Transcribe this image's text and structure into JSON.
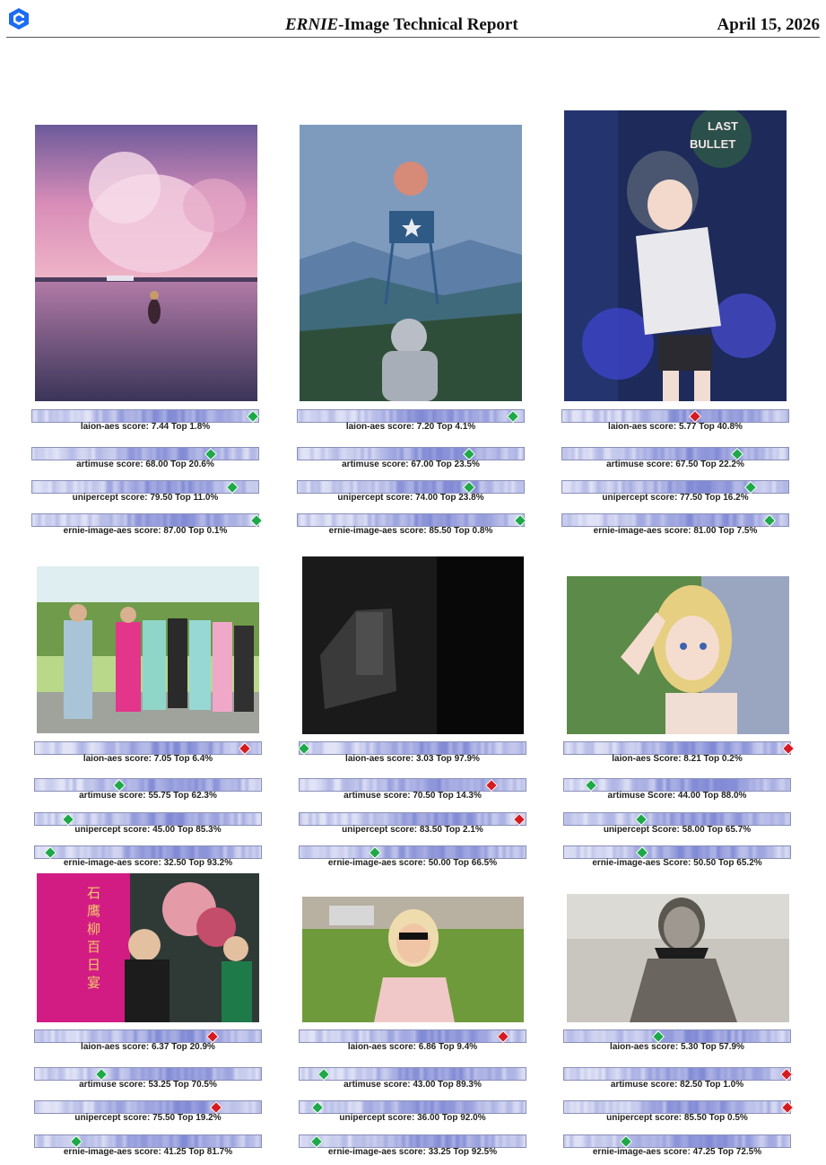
{
  "header": {
    "title_italic": "ERNIE",
    "title_rest": "-Image Technical Report",
    "date": "April 15, 2026"
  },
  "colors": {
    "good_marker": "#1ea84a",
    "bad_marker": "#d51b22",
    "bar_stripe": "#6f79cf",
    "bar_background": "#e8eaf8"
  },
  "panels": [
    {
      "subject": "pink sunset sea swimmer",
      "metrics": [
        {
          "label": "laion-aes score: 7.44 Top 1.8%",
          "percentile": 0.982,
          "marker": "green"
        },
        {
          "label": "artimuse score: 68.00 Top 20.6%",
          "percentile": 0.794,
          "marker": "green"
        },
        {
          "label": "unipercept score: 79.50 Top 11.0%",
          "percentile": 0.89,
          "marker": "green"
        },
        {
          "label": "ernie-image-aes score: 87.00 Top 0.1%",
          "percentile": 0.999,
          "marker": "green"
        }
      ]
    },
    {
      "subject": "astronaut water tower moon",
      "metrics": [
        {
          "label": "laion-aes score: 7.20 Top 4.1%",
          "percentile": 0.959,
          "marker": "green"
        },
        {
          "label": "artimuse score: 67.00 Top 23.5%",
          "percentile": 0.765,
          "marker": "green"
        },
        {
          "label": "unipercept score: 74.00 Top 23.8%",
          "percentile": 0.762,
          "marker": "green"
        },
        {
          "label": "ernie-image-aes score: 85.50 Top 0.8%",
          "percentile": 0.992,
          "marker": "green"
        }
      ]
    },
    {
      "subject": "anime girl last bullet",
      "metrics": [
        {
          "label": "laion-aes score: 5.77 Top 40.8%",
          "percentile": 0.592,
          "marker": "red"
        },
        {
          "label": "artimuse score: 67.50 Top 22.2%",
          "percentile": 0.778,
          "marker": "green"
        },
        {
          "label": "unipercept score: 77.50 Top 16.2%",
          "percentile": 0.838,
          "marker": "green"
        },
        {
          "label": "ernie-image-aes score: 81.00 Top 7.5%",
          "percentile": 0.925,
          "marker": "green"
        }
      ]
    },
    {
      "subject": "group photo tai chi",
      "metrics": [
        {
          "label": "laion-aes score: 7.05 Top 6.4%",
          "percentile": 0.936,
          "marker": "red"
        },
        {
          "label": "artimuse score: 55.75 Top 62.3%",
          "percentile": 0.377,
          "marker": "green"
        },
        {
          "label": "unipercept score: 45.00 Top 85.3%",
          "percentile": 0.147,
          "marker": "green"
        },
        {
          "label": "ernie-image-aes score: 32.50 Top 93.2%",
          "percentile": 0.068,
          "marker": "green"
        }
      ]
    },
    {
      "subject": "dark blurry frame",
      "metrics": [
        {
          "label": "laion-aes score: 3.03 Top 97.9%",
          "percentile": 0.021,
          "marker": "green"
        },
        {
          "label": "artimuse score: 70.50 Top 14.3%",
          "percentile": 0.857,
          "marker": "red"
        },
        {
          "label": "unipercept score: 83.50 Top 2.1%",
          "percentile": 0.979,
          "marker": "red"
        },
        {
          "label": "ernie-image-aes score: 50.00 Top 66.5%",
          "percentile": 0.335,
          "marker": "green"
        }
      ]
    },
    {
      "subject": "3d blonde girl waving",
      "metrics": [
        {
          "label": "laion-aes Score: 8.21 Top 0.2%",
          "percentile": 0.998,
          "marker": "red"
        },
        {
          "label": "artimuse Score: 44.00 Top 88.0%",
          "percentile": 0.12,
          "marker": "green"
        },
        {
          "label": "unipercept Score: 58.00 Top 65.7%",
          "percentile": 0.343,
          "marker": "green"
        },
        {
          "label": "ernie-image-aes Score: 50.50 Top 65.2%",
          "percentile": 0.348,
          "marker": "green"
        }
      ]
    },
    {
      "subject": "banquet magenta backdrop",
      "sign_text": [
        "石",
        "鹰",
        "柳",
        "百",
        "日",
        "宴"
      ],
      "metrics": [
        {
          "label": "laion-aes score: 6.37 Top 20.9%",
          "percentile": 0.791,
          "marker": "red"
        },
        {
          "label": "artimuse score: 53.25 Top 70.5%",
          "percentile": 0.295,
          "marker": "green"
        },
        {
          "label": "unipercept score: 75.50 Top 19.2%",
          "percentile": 0.808,
          "marker": "red"
        },
        {
          "label": "ernie-image-aes score: 41.25 Top 81.7%",
          "percentile": 0.183,
          "marker": "green"
        }
      ]
    },
    {
      "subject": "woman in garden sunglasses",
      "metrics": [
        {
          "label": "laion-aes score: 6.86 Top 9.4%",
          "percentile": 0.906,
          "marker": "red"
        },
        {
          "label": "artimuse score: 43.00 Top 89.3%",
          "percentile": 0.107,
          "marker": "green"
        },
        {
          "label": "unipercept score: 36.00 Top 92.0%",
          "percentile": 0.08,
          "marker": "green"
        },
        {
          "label": "ernie-image-aes score: 33.25 Top 92.5%",
          "percentile": 0.075,
          "marker": "green"
        }
      ]
    },
    {
      "subject": "vintage black-and-white portrait",
      "metrics": [
        {
          "label": "laion-aes score: 5.30 Top 57.9%",
          "percentile": 0.421,
          "marker": "green"
        },
        {
          "label": "artimuse score: 82.50 Top 1.0%",
          "percentile": 0.99,
          "marker": "red"
        },
        {
          "label": "unipercept score: 85.50 Top 0.5%",
          "percentile": 0.995,
          "marker": "red"
        },
        {
          "label": "ernie-image-aes score: 47.25 Top 72.5%",
          "percentile": 0.275,
          "marker": "green"
        }
      ]
    }
  ]
}
